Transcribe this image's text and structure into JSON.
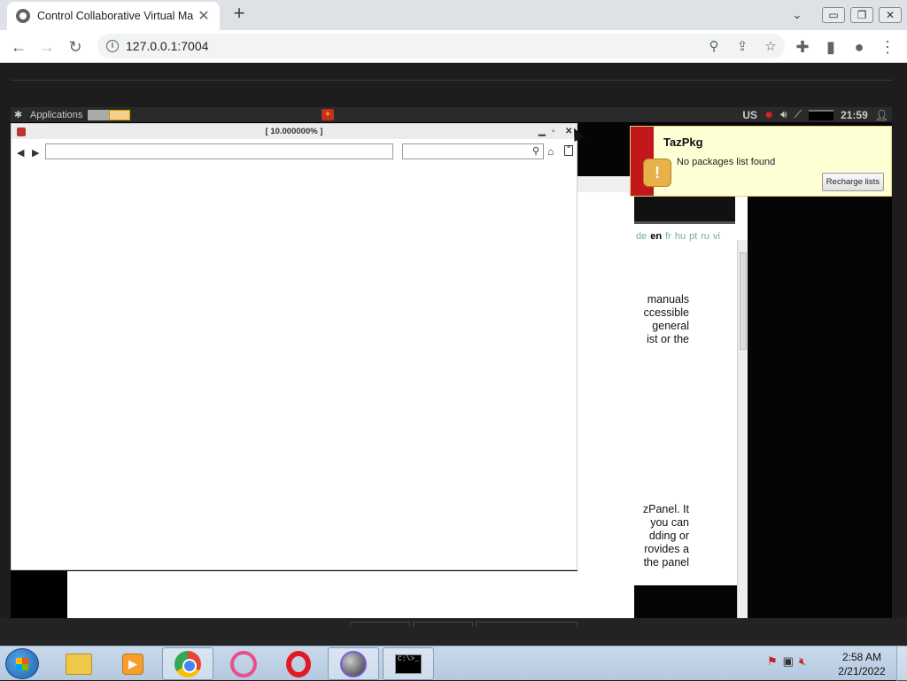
{
  "browser": {
    "tab_title": "Control Collaborative Virtual Ma",
    "tab_close": "✕",
    "new_tab": "+",
    "url": "127.0.0.1:7004",
    "window_controls": {
      "minimize": "▭",
      "restore": "❐",
      "close": "✕"
    }
  },
  "vm_panel": {
    "applications_label": "Applications",
    "keyboard_layout": "US",
    "clock": "21:59"
  },
  "helpbrowser": {
    "languages": [
      "de",
      "en",
      "fr",
      "hu",
      "pt",
      "ru",
      "vi"
    ],
    "current_language": "en",
    "text_block_1": [
      "manuals",
      "ccessible",
      "general",
      "ist or the"
    ],
    "text_block_2": [
      "zPanel. It",
      "you can",
      "dding or",
      "rovides a",
      "the panel"
    ]
  },
  "viewer_window": {
    "title": "[ 10.000000% ]",
    "address_value": "",
    "search_value": ""
  },
  "notification": {
    "title": "TazPkg",
    "message": "No packages list found",
    "button_label": "Recharge lists",
    "icon_glyph": "!"
  },
  "taskbar": {
    "clock_time": "2:58 AM",
    "clock_date": "2/21/2022",
    "cmd_text": "C:\\>_"
  }
}
